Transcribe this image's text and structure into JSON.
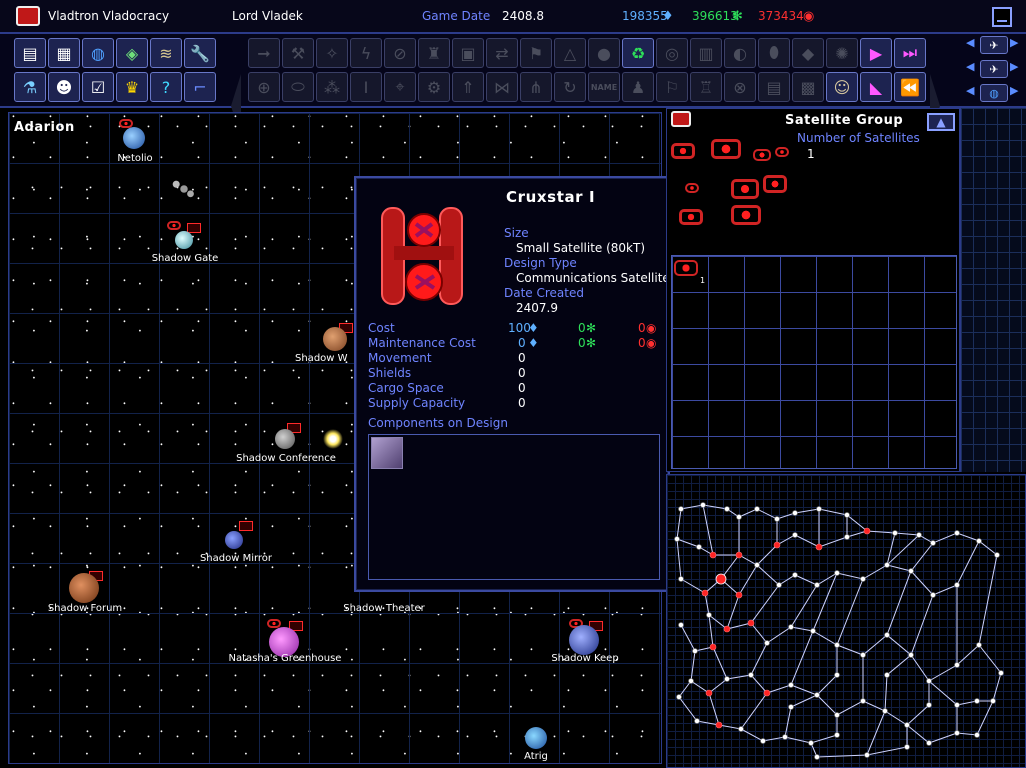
{
  "topbar": {
    "empire_name": "Vladtron Vladocracy",
    "leader_name": "Lord Vladek",
    "game_date_label": "Game Date",
    "game_date_value": "2408.8",
    "minerals": "198355",
    "organics": "396613",
    "radioactives": "373434"
  },
  "toolbar": {
    "left_row1": [
      "report-icon",
      "circuit-icon",
      "globe-icon",
      "map-icon",
      "ships-icon",
      "wrench-icon"
    ],
    "left_row2": [
      "flask-icon",
      "alien-icon",
      "checklist-icon",
      "crown-icon",
      "help-icon",
      "pipe-icon"
    ],
    "name_button": "NAME"
  },
  "map": {
    "system_name": "Adarion",
    "planets": [
      "Netolio",
      "Shadow Gate",
      "Shadow W",
      "Shadow Conference",
      "Shadow Mirror",
      "Shadow Forum",
      "Shadow Theater",
      "Natasha's Greenhouse",
      "Shadow Keep",
      "Atrig"
    ]
  },
  "detail": {
    "title": "Cruxstar I",
    "size_label": "Size",
    "size_value": "Small Satellite (80kT)",
    "design_type_label": "Design Type",
    "design_type_value": "Communications Satellite",
    "date_created_label": "Date Created",
    "date_created_value": "2407.9",
    "cost_label": "Cost",
    "cost_minerals": "100",
    "cost_organics": "0",
    "cost_radioactives": "0",
    "maint_label": "Maintenance Cost",
    "maint_minerals": "0",
    "maint_organics": "0",
    "maint_radioactives": "0",
    "movement_label": "Movement",
    "movement_value": "0",
    "shields_label": "Shields",
    "shields_value": "0",
    "cargo_label": "Cargo Space",
    "cargo_value": "0",
    "supply_label": "Supply Capacity",
    "supply_value": "0",
    "components_label": "Components on Design"
  },
  "side": {
    "title": "Satellite Group",
    "count_label": "Number of Satellites",
    "count_value": "1",
    "cargo_slot_count": "1"
  },
  "colors": {
    "label_blue": "#6f84ff",
    "panel_border": "#2c3b8a",
    "ship_red": "#d02424",
    "organics_green": "#2ee05a",
    "minerals_blue": "#5fb0ff",
    "radioactives_red": "#ff3030"
  }
}
